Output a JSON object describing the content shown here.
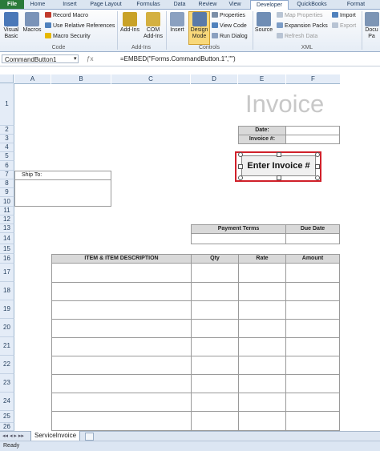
{
  "ribbon": {
    "tabs": [
      "File",
      "Home",
      "Insert",
      "Page Layout",
      "Formulas",
      "Data",
      "Review",
      "View",
      "Developer",
      "QuickBooks",
      "Format"
    ],
    "active_tab": "Developer",
    "code": {
      "group_label": "Code",
      "visual_basic": "Visual Basic",
      "macros": "Macros",
      "record_macro": "Record Macro",
      "use_relative": "Use Relative References",
      "macro_security": "Macro Security"
    },
    "addins": {
      "group_label": "Add-Ins",
      "addins": "Add-Ins",
      "com_addins": "COM Add-Ins"
    },
    "controls": {
      "group_label": "Controls",
      "insert": "Insert",
      "design_mode": "Design Mode",
      "properties": "Properties",
      "view_code": "View Code",
      "run_dialog": "Run Dialog"
    },
    "xml": {
      "group_label": "XML",
      "source": "Source",
      "map_properties": "Map Properties",
      "expansion_packs": "Expansion Packs",
      "refresh_data": "Refresh Data",
      "import": "Import",
      "export": "Export"
    },
    "modify": {
      "document_panel": "Docu Pa"
    }
  },
  "formula_bar": {
    "name_box": "CommandButton1",
    "formula": "=EMBED(\"Forms.CommandButton.1\",\"\")"
  },
  "columns": [
    "A",
    "B",
    "C",
    "D",
    "E",
    "F"
  ],
  "rows": [
    "1",
    "2",
    "3",
    "4",
    "5",
    "6",
    "7",
    "8",
    "9",
    "10",
    "11",
    "12",
    "13",
    "14",
    "15",
    "16",
    "17",
    "18",
    "19",
    "20",
    "21",
    "22",
    "23",
    "24",
    "25",
    "26"
  ],
  "sheet": {
    "title": "Invoice",
    "date_label": "Date:",
    "invoice_label": "Invoice #:",
    "button_label": "Enter Invoice #",
    "ship_to": "Ship To:",
    "payment_terms": "Payment Terms",
    "due_date": "Due Date",
    "items_header": [
      "ITEM & ITEM DESCRIPTION",
      "Qty",
      "Rate",
      "Amount"
    ]
  },
  "sheet_tab": "ServiceInvoice",
  "status": "Ready"
}
